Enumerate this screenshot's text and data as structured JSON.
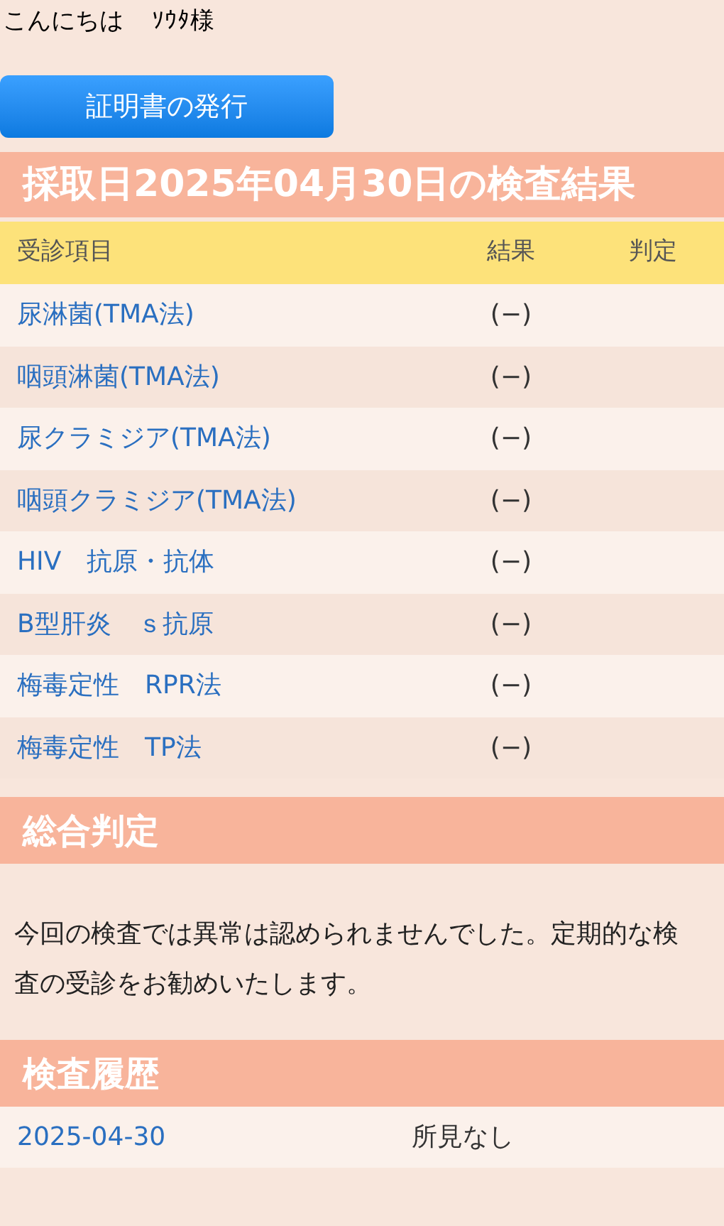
{
  "greeting": {
    "text": "こんにちは",
    "name": "ｿｳﾀ様"
  },
  "certificate_button": "証明書の発行",
  "results_title": "採取日2025年04月30日の検査結果",
  "table": {
    "columns": [
      "受診項目",
      "結果",
      "判定"
    ],
    "rows": [
      {
        "item": "尿淋菌(TMA法)",
        "result": "(−)"
      },
      {
        "item": "咽頭淋菌(TMA法)",
        "result": "(−)"
      },
      {
        "item": "尿クラミジア(TMA法)",
        "result": "(−)"
      },
      {
        "item": "咽頭クラミジア(TMA法)",
        "result": "(−)"
      },
      {
        "item": "HIV　抗原・抗体",
        "result": "(−)"
      },
      {
        "item": "B型肝炎　ｓ抗原",
        "result": "(−)"
      },
      {
        "item": "梅毒定性　RPR法",
        "result": "(−)"
      },
      {
        "item": "梅毒定性　TP法",
        "result": "(−)"
      }
    ]
  },
  "overall_title": "総合判定",
  "overall_message": "今回の検査では異常は認められませんでした。定期的な検査の受診をお勧めいたします。",
  "history_title": "検査履歴",
  "history": [
    {
      "date": "2025-04-30",
      "finding": "所見なし"
    }
  ]
}
